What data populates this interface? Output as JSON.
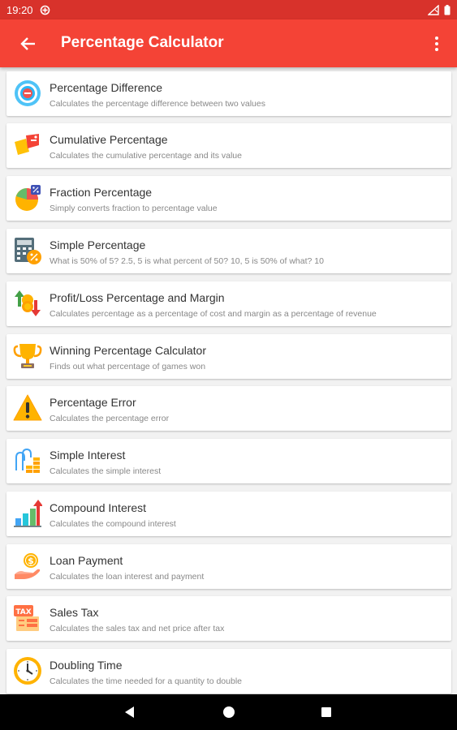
{
  "status": {
    "time": "19:20"
  },
  "appbar": {
    "title": "Percentage Calculator"
  },
  "items": [
    {
      "icon": "target-percent-icon",
      "title": "Percentage Difference",
      "subtitle": "Calculates the percentage difference between two values"
    },
    {
      "icon": "tags-icon",
      "title": "Cumulative Percentage",
      "subtitle": "Calculates the cumulative percentage and its value"
    },
    {
      "icon": "pie-chart-icon",
      "title": "Fraction Percentage",
      "subtitle": "Simply converts fraction to percentage value"
    },
    {
      "icon": "calculator-icon",
      "title": "Simple Percentage",
      "subtitle": "What is 50% of 5? 2.5, 5 is what percent of 50? 10, 5 is 50% of what? 10"
    },
    {
      "icon": "profit-loss-icon",
      "title": "Profit/Loss Percentage and Margin",
      "subtitle": "Calculates percentage as a percentage of cost and margin as a percentage of revenue"
    },
    {
      "icon": "trophy-icon",
      "title": "Winning Percentage Calculator",
      "subtitle": "Finds out what percentage of games won"
    },
    {
      "icon": "warning-icon",
      "title": "Percentage Error",
      "subtitle": "Calculates the percentage error"
    },
    {
      "icon": "coin-stacks-icon",
      "title": "Simple Interest",
      "subtitle": "Calculates the simple interest"
    },
    {
      "icon": "growth-chart-icon",
      "title": "Compound Interest",
      "subtitle": "Calculates the compound interest"
    },
    {
      "icon": "loan-hand-icon",
      "title": "Loan Payment",
      "subtitle": "Calculates the loan interest and payment"
    },
    {
      "icon": "tax-icon",
      "title": "Sales Tax",
      "subtitle": "Calculates the sales tax and net price after tax"
    },
    {
      "icon": "clock-icon",
      "title": "Doubling Time",
      "subtitle": "Calculates the time needed for a quantity to double"
    }
  ],
  "colors": {
    "primary": "#f44336",
    "status_bar": "#d8322b",
    "background": "#f2f2f2"
  }
}
